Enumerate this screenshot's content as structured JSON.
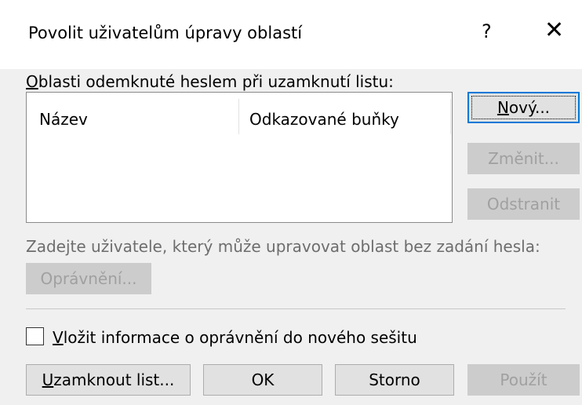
{
  "dialog": {
    "title": "Povolit uživatelům úpravy oblastí",
    "help_label": "?",
    "close_glyph": "✕"
  },
  "ranges": {
    "label_u": "O",
    "label_rest": "blasti odemknuté heslem při uzamknutí listu:",
    "columns": [
      "Název",
      "Odkazované buňky"
    ]
  },
  "buttons": {
    "new": {
      "u": "N",
      "rest": "ový..."
    },
    "modify": "Změnit...",
    "delete": "Odstranit",
    "permissions": "Oprávnění...",
    "protect": {
      "u": "U",
      "rest": "zamknout list..."
    },
    "ok": "OK",
    "cancel": "Storno",
    "apply": "Použít"
  },
  "hint_text": "Zadejte uživatele, který může upravovat oblast bez zadání hesla:",
  "checkbox": {
    "u": "V",
    "rest": "ložit informace o oprávnění do nového sešitu",
    "checked": false
  }
}
